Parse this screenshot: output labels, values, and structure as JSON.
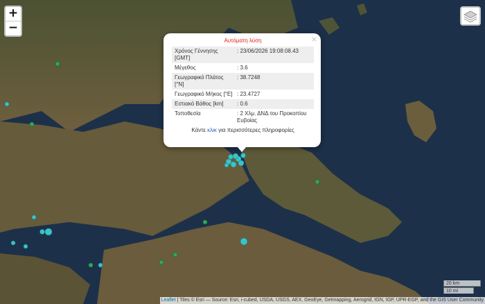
{
  "map": {
    "zoom_in": "+",
    "zoom_out": "−"
  },
  "popup": {
    "title": "Αυτόματη λύση",
    "close": "×",
    "rows": [
      {
        "label": "Χρόνος Γέννησης [GMT]",
        "value": ": 23/06/2026 19:08:08.43"
      },
      {
        "label": "Μέγεθος",
        "value": ": 3.6"
      },
      {
        "label": "Γεωγραφικό Πλάτος [°N]",
        "value": ": 38.7248"
      },
      {
        "label": "Γεωγραφικό Μήκος [°E]",
        "value": ": 23.4727"
      },
      {
        "label": "Εστιακό Βάθος [km]",
        "value": ": 0.6"
      },
      {
        "label": "Τοποθεσία",
        "value": ": 2 Χλμ. ΔΝΔ του Προκοπίου Ευβοίας"
      }
    ],
    "footer_prefix": "Κάντε ",
    "footer_link": "κλικ",
    "footer_suffix": " για περισσότερες πληροφορίες"
  },
  "scale": {
    "metric": "20 km",
    "imperial": "10 mi"
  },
  "attribution": {
    "leaflet": "Leaflet",
    "text": " | Tiles © Esri — Source: Esri, i-cubed, USDA, USGS, AEX, GeoEye, Getmapping, Aerogrid, IGN, IGP, UPR-EGP, and the GIS User Community"
  },
  "colors": {
    "sea": "#1c2f4a",
    "land": "#5f5a3b",
    "quake_marker": "#3ac4c8",
    "old_marker": "#2eab58",
    "popup_title": "#e0201b"
  }
}
